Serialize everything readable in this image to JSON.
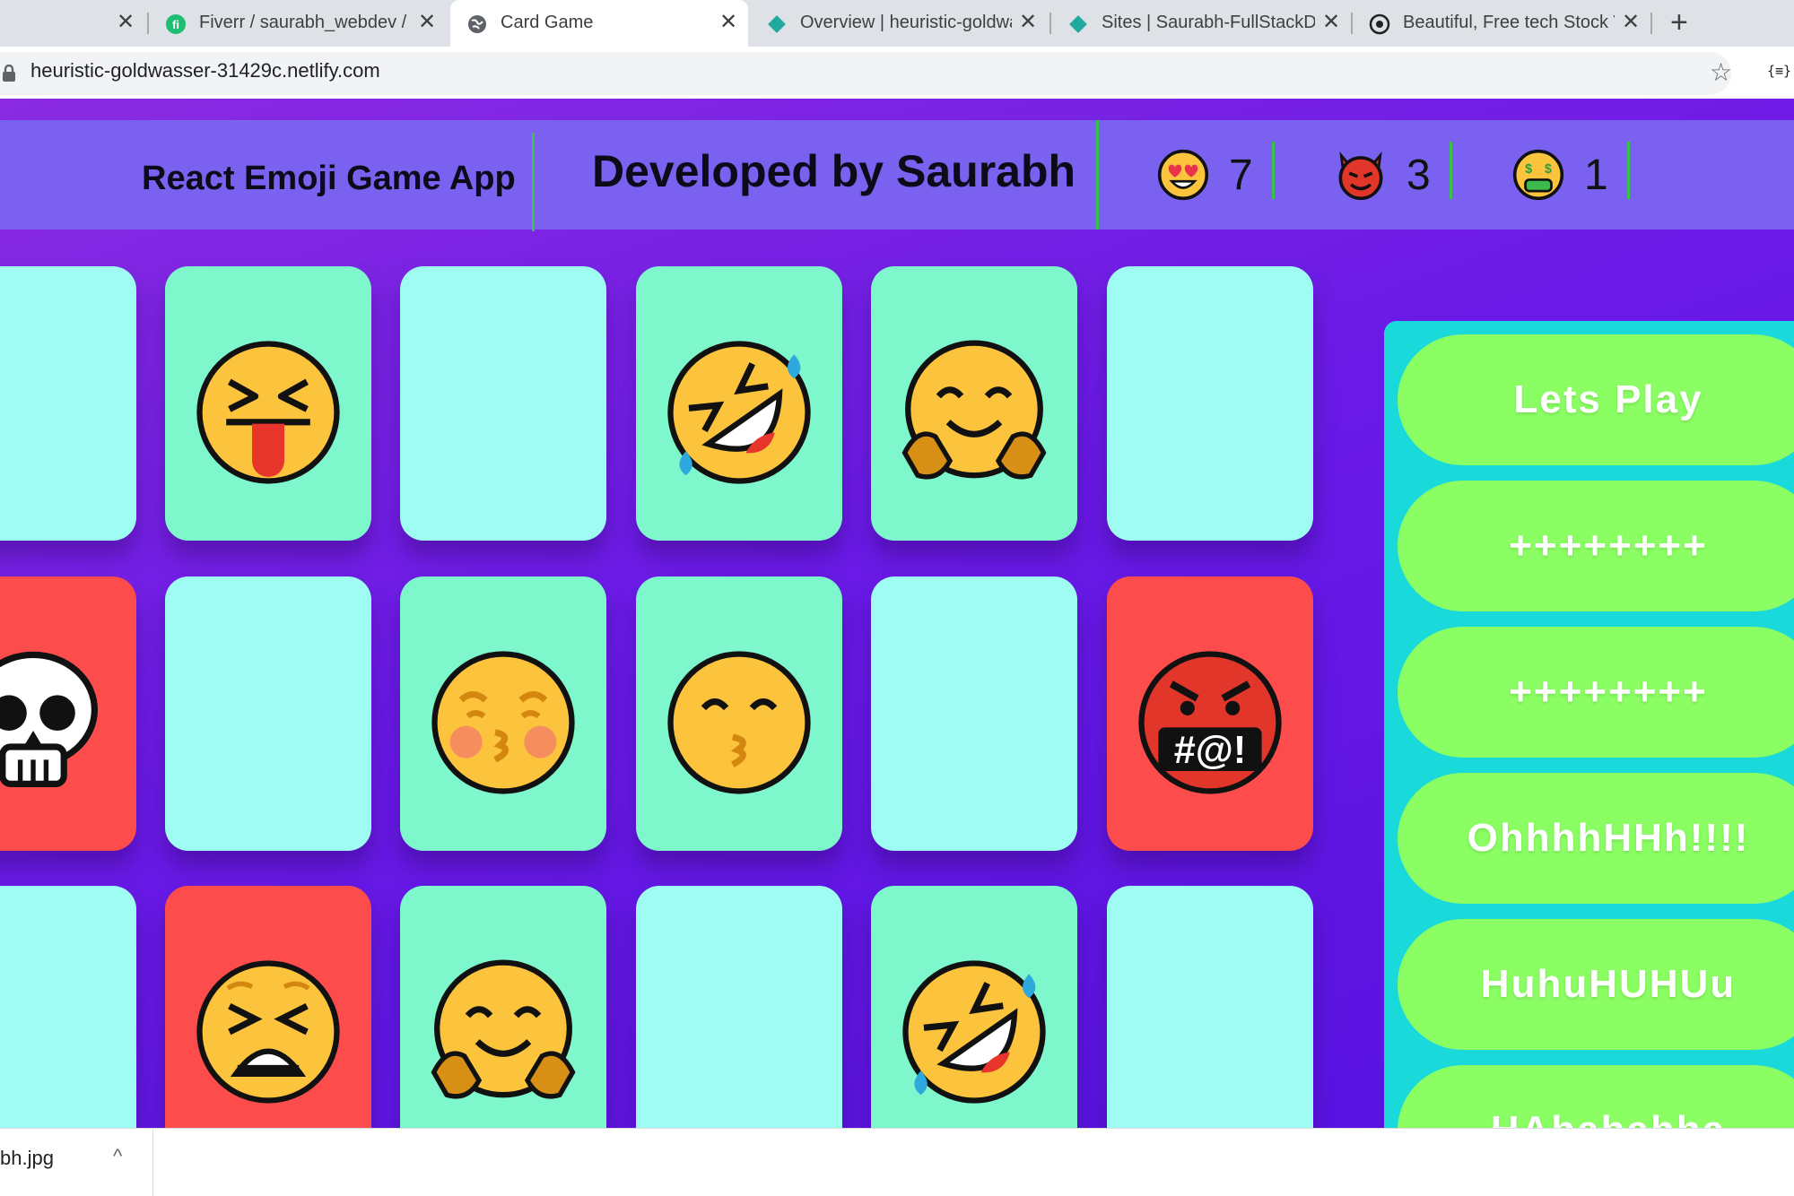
{
  "browser": {
    "tabs": [
      {
        "title": "",
        "active": false,
        "icon": "none"
      },
      {
        "title": "Fiverr / saurabh_webdev / Ed",
        "active": false,
        "icon": "fiverr-icon"
      },
      {
        "title": "Card Game",
        "active": true,
        "icon": "globe-icon"
      },
      {
        "title": "Overview | heuristic-goldwas",
        "active": false,
        "icon": "netlify-icon"
      },
      {
        "title": "Sites | Saurabh-FullStackDev",
        "active": false,
        "icon": "netlify-icon"
      },
      {
        "title": "Beautiful, Free tech Stock Vid",
        "active": false,
        "icon": "pexels-icon"
      }
    ],
    "close_glyph": "✕",
    "new_tab_glyph": "+",
    "url": "heuristic-goldwasser-31429c.netlify.com",
    "star_glyph": "☆",
    "ext_label": "{≡}"
  },
  "header": {
    "app_title": "React Emoji Game App",
    "developer": "Developed by Saurabh",
    "stats": [
      {
        "emoji": "heart-eyes-face",
        "value": "7"
      },
      {
        "emoji": "smiling-devil-face",
        "value": "3"
      },
      {
        "emoji": "money-mouth-face",
        "value": "1"
      }
    ]
  },
  "cards": [
    {
      "color": "cyan",
      "emoji": "none"
    },
    {
      "color": "mint",
      "emoji": "squinting-tongue-face"
    },
    {
      "color": "cyan",
      "emoji": "none"
    },
    {
      "color": "mint",
      "emoji": "rolling-laughing-face"
    },
    {
      "color": "mint",
      "emoji": "hugging-face"
    },
    {
      "color": "cyan",
      "emoji": "none"
    },
    {
      "color": "red",
      "emoji": "skull"
    },
    {
      "color": "cyan",
      "emoji": "none"
    },
    {
      "color": "mint",
      "emoji": "blushing-kissing-face"
    },
    {
      "color": "mint",
      "emoji": "kissing-smiling-eyes-face"
    },
    {
      "color": "cyan",
      "emoji": "none"
    },
    {
      "color": "red",
      "emoji": "cursing-face"
    },
    {
      "color": "cyan",
      "emoji": "none"
    },
    {
      "color": "red",
      "emoji": "tired-face"
    },
    {
      "color": "mint",
      "emoji": "hugging-face"
    },
    {
      "color": "cyan",
      "emoji": "none"
    },
    {
      "color": "mint",
      "emoji": "rolling-laughing-face"
    },
    {
      "color": "cyan",
      "emoji": "none"
    }
  ],
  "messages": [
    "Lets Play",
    "++++++++",
    "++++++++",
    "OhhhhHHh!!!!",
    "HuhuHUHUu",
    "HAhahahha"
  ],
  "download": {
    "filename": "bh.jpg",
    "chevron": "^"
  },
  "colors": {
    "cyan_card": "#9ffcf2",
    "mint_card": "#7ef7cc",
    "red_card": "#fd4c4c",
    "header": "#7b61f0",
    "panel": "#19d9db",
    "pill": "#8afe63"
  }
}
